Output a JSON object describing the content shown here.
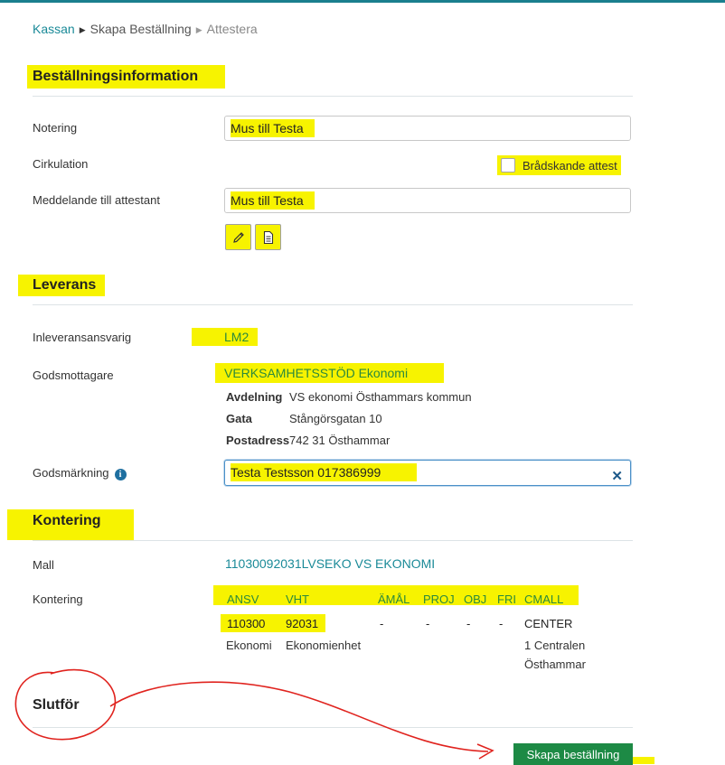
{
  "breadcrumb": {
    "home": "Kassan",
    "step": "Skapa Beställning",
    "current": "Attestera"
  },
  "order_info": {
    "title": "Beställningsinformation",
    "notering_label": "Notering",
    "notering_value": "Mus till Testa",
    "cirkulation_label": "Cirkulation",
    "urgent_label": "Brådskande attest",
    "meddelande_label": "Meddelande till attestant",
    "meddelande_value": "Mus till Testa"
  },
  "delivery": {
    "title": "Leverans",
    "inleverans_label": "Inleveransansvarig",
    "inleverans_value": "LM2",
    "godsmottagare_label": "Godsmottagare",
    "godsmottagare_value": "VERKSAMHETSSTÖD Ekonomi",
    "avdelning_label": "Avdelning",
    "avdelning_value": "VS ekonomi Östhammars kommun",
    "gata_label": "Gata",
    "gata_value": "Stångörsgatan 10",
    "postadress_label": "Postadress",
    "postadress_value": "742 31 Östhammar",
    "godsmarkning_label": "Godsmärkning",
    "godsmarkning_value": "Testa Testsson 017386999"
  },
  "kontering": {
    "title": "Kontering",
    "mall_label": "Mall",
    "mall_value": "11030092031LVSEKO VS EKONOMI",
    "kontering_label": "Kontering",
    "headers": [
      "ANSV",
      "VHT",
      "ÄMÅL",
      "PROJ",
      "OBJ",
      "FRI",
      "CMALL"
    ],
    "values": [
      "110300",
      "92031",
      "-",
      "-",
      "-",
      "-",
      "CENTER"
    ],
    "desc_ansv": "Ekonomi",
    "desc_vht": "Ekonomienhet",
    "desc_cmall_1": "1 Centralen",
    "desc_cmall_2": "Östhammar"
  },
  "finish": {
    "title": "Slutför",
    "submit_label": "Skapa beställning"
  },
  "colors": {
    "accent": "#1a8a98",
    "highlight": "#f7f300",
    "primary_button": "#1d8a45",
    "annotation": "#e0231e"
  },
  "icons": [
    "pencil-icon",
    "document-icon",
    "info-icon",
    "close-icon"
  ]
}
